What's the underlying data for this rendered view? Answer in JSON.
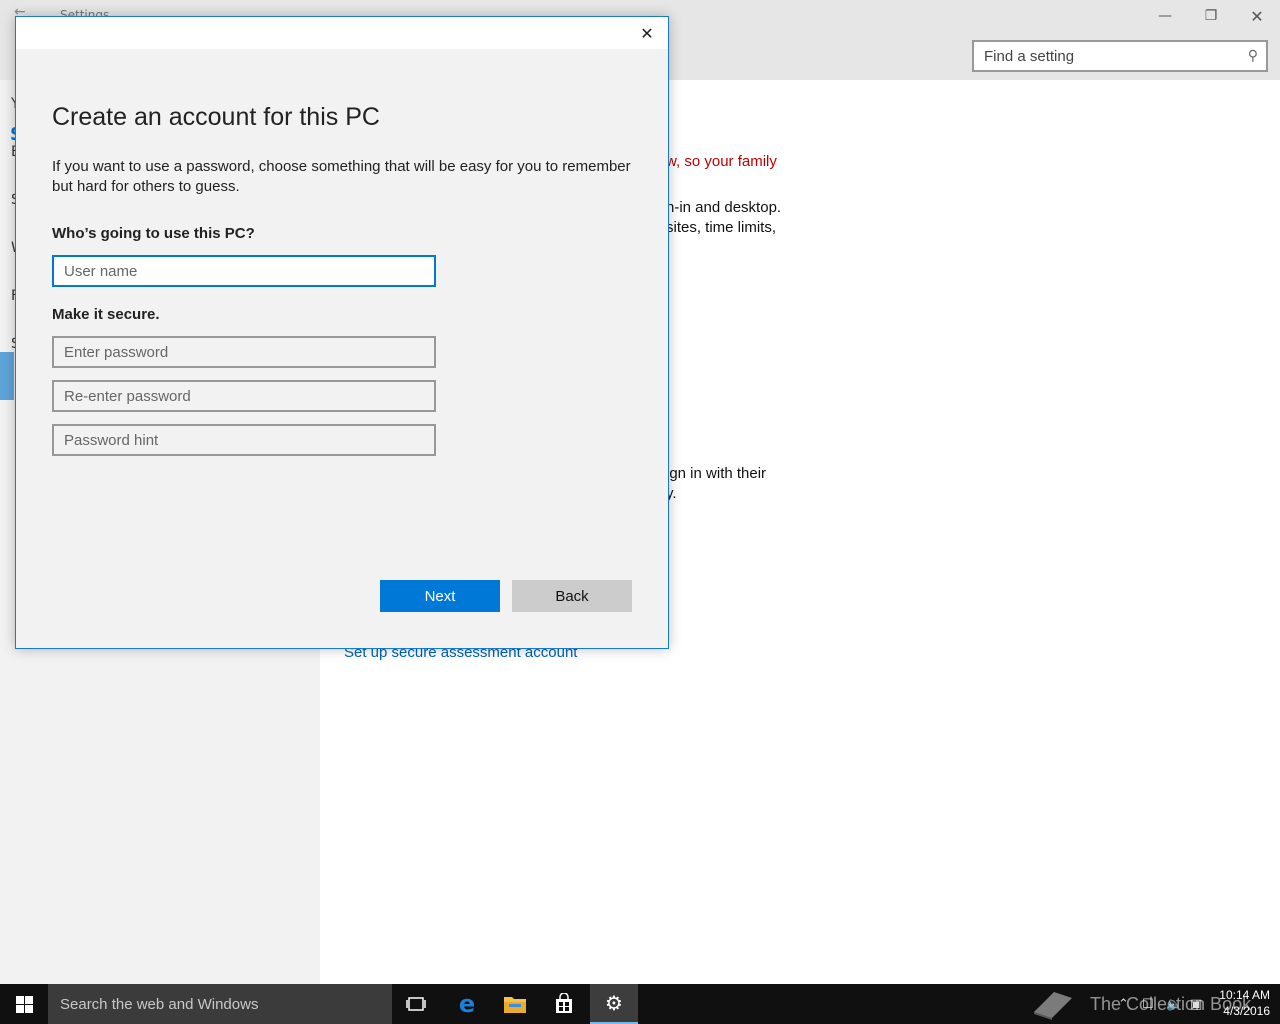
{
  "window": {
    "title": "Settings",
    "back": "←",
    "minimize": "—",
    "maximize": "❐",
    "close": "✕"
  },
  "search": {
    "placeholder": "Find a setting",
    "icon": "search-icon"
  },
  "left_nav": {
    "items": [
      "Y",
      "E",
      "S",
      "W",
      "F",
      "S"
    ],
    "selected_index": 4
  },
  "background_content": {
    "line1_red": "w, so your family",
    "line2": "n-in and desktop.",
    "line3": "sites, time limits,",
    "line4": "ign in with their",
    "line5": "y.",
    "link": "Set up secure assessment account"
  },
  "dialog": {
    "close": "✕",
    "heading": "Create an account for this PC",
    "description": "If you want to use a password, choose something that will be easy for you to remember but hard for others to guess.",
    "who_label": "Who’s going to use this PC?",
    "username_placeholder": "User name",
    "secure_label": "Make it secure.",
    "password_placeholder": "Enter password",
    "reenter_placeholder": "Re-enter password",
    "hint_placeholder": "Password hint",
    "next_label": "Next",
    "back_label": "Back"
  },
  "taskbar": {
    "search_placeholder": "Search the web and Windows",
    "watermark": "The Collection Book",
    "time": "10:14 AM",
    "date": "4/3/2016",
    "accent": "#0078d7"
  }
}
